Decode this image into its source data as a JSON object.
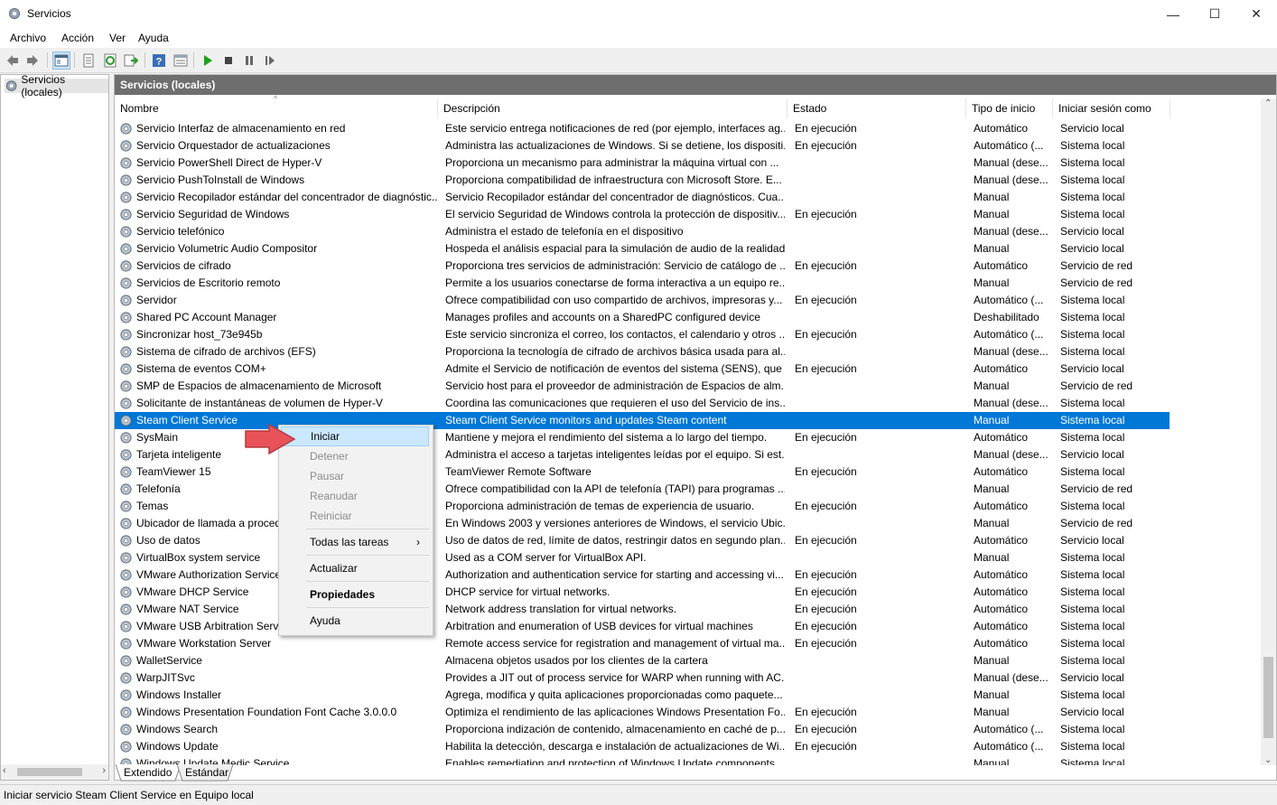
{
  "window": {
    "title": "Servicios",
    "minimize": "—",
    "maximize": "☐",
    "close": "✕"
  },
  "menu": [
    "Archivo",
    "Acción",
    "Ver",
    "Ayuda"
  ],
  "tree": {
    "node": "Servicios (locales)"
  },
  "panel": {
    "header": "Servicios (locales)"
  },
  "columns": [
    "Nombre",
    "Descripción",
    "Estado",
    "Tipo de inicio",
    "Iniciar sesión como"
  ],
  "services": [
    [
      "Servicio Interfaz de almacenamiento en red",
      "Este servicio entrega notificaciones de red (por ejemplo, interfaces ag...",
      "En ejecución",
      "Automático",
      "Servicio local"
    ],
    [
      "Servicio Orquestador de actualizaciones",
      "Administra las actualizaciones de Windows. Si se detiene, los dispositi...",
      "En ejecución",
      "Automático (...",
      "Sistema local"
    ],
    [
      "Servicio PowerShell Direct de Hyper-V",
      "Proporciona un mecanismo para administrar la máquina virtual con ...",
      "",
      "Manual (dese...",
      "Sistema local"
    ],
    [
      "Servicio PushToInstall de Windows",
      "Proporciona compatibilidad de infraestructura con Microsoft Store. E...",
      "",
      "Manual (dese...",
      "Sistema local"
    ],
    [
      "Servicio Recopilador estándar del concentrador de diagnóstic...",
      "Servicio Recopilador estándar del concentrador de diagnósticos. Cua...",
      "",
      "Manual",
      "Sistema local"
    ],
    [
      "Servicio Seguridad de Windows",
      "El servicio Seguridad de Windows controla la protección de dispositiv...",
      "En ejecución",
      "Manual",
      "Sistema local"
    ],
    [
      "Servicio telefónico",
      "Administra el estado de telefonía en el dispositivo",
      "",
      "Manual (dese...",
      "Servicio local"
    ],
    [
      "Servicio Volumetric Audio Compositor",
      "Hospeda el análisis espacial para la simulación de audio de la realidad...",
      "",
      "Manual",
      "Servicio local"
    ],
    [
      "Servicios de cifrado",
      "Proporciona tres servicios de administración: Servicio de catálogo de ...",
      "En ejecución",
      "Automático",
      "Servicio de red"
    ],
    [
      "Servicios de Escritorio remoto",
      "Permite a los usuarios conectarse de forma interactiva a un equipo re...",
      "",
      "Manual",
      "Servicio de red"
    ],
    [
      "Servidor",
      "Ofrece compatibilidad con uso compartido de archivos, impresoras y...",
      "En ejecución",
      "Automático (...",
      "Sistema local"
    ],
    [
      "Shared PC Account Manager",
      "Manages profiles and accounts on a SharedPC configured device",
      "",
      "Deshabilitado",
      "Sistema local"
    ],
    [
      "Sincronizar host_73e945b",
      "Este servicio sincroniza el correo, los contactos, el calendario y otros ...",
      "En ejecución",
      "Automático (...",
      "Sistema local"
    ],
    [
      "Sistema de cifrado de archivos (EFS)",
      "Proporciona la tecnología de cifrado de archivos básica usada para al...",
      "",
      "Manual (dese...",
      "Sistema local"
    ],
    [
      "Sistema de eventos COM+",
      "Admite el Servicio de notificación de eventos del sistema (SENS), que ...",
      "En ejecución",
      "Automático",
      "Servicio local"
    ],
    [
      "SMP de Espacios de almacenamiento de Microsoft",
      "Servicio host para el proveedor de administración de Espacios de alm...",
      "",
      "Manual",
      "Servicio de red"
    ],
    [
      "Solicitante de instantáneas de volumen de Hyper-V",
      "Coordina las comunicaciones que requieren el uso del Servicio de ins...",
      "",
      "Manual (dese...",
      "Sistema local"
    ],
    [
      "Steam Client Service",
      "Steam Client Service monitors and updates Steam content",
      "",
      "Manual",
      "Sistema local"
    ],
    [
      "SysMain",
      "Mantiene y mejora el rendimiento del sistema a lo largo del tiempo.",
      "En ejecución",
      "Automático",
      "Sistema local"
    ],
    [
      "Tarjeta inteligente",
      "Administra el acceso a tarjetas inteligentes leídas por el equipo. Si est...",
      "",
      "Manual (dese...",
      "Servicio local"
    ],
    [
      "TeamViewer 15",
      "TeamViewer Remote Software",
      "En ejecución",
      "Automático",
      "Sistema local"
    ],
    [
      "Telefonía",
      "Ofrece compatibilidad con la API de telefonía (TAPI) para programas ...",
      "",
      "Manual",
      "Servicio de red"
    ],
    [
      "Temas",
      "Proporciona administración de temas de experiencia de usuario.",
      "En ejecución",
      "Automático",
      "Sistema local"
    ],
    [
      "Ubicador de llamada a proced",
      "En Windows 2003 y versiones anteriores de Windows, el servicio Ubic...",
      "",
      "Manual",
      "Servicio de red"
    ],
    [
      "Uso de datos",
      "Uso de datos de red, límite de datos, restringir datos en segundo plan...",
      "En ejecución",
      "Automático",
      "Servicio local"
    ],
    [
      "VirtualBox system service",
      "Used as a COM server for VirtualBox API.",
      "",
      "Manual",
      "Sistema local"
    ],
    [
      "VMware Authorization Service",
      "Authorization and authentication service for starting and accessing vi...",
      "En ejecución",
      "Automático",
      "Sistema local"
    ],
    [
      "VMware DHCP Service",
      "DHCP service for virtual networks.",
      "En ejecución",
      "Automático",
      "Sistema local"
    ],
    [
      "VMware NAT Service",
      "Network address translation for virtual networks.",
      "En ejecución",
      "Automático",
      "Sistema local"
    ],
    [
      "VMware USB Arbitration Servic",
      "Arbitration and enumeration of USB devices for virtual machines",
      "En ejecución",
      "Automático",
      "Sistema local"
    ],
    [
      "VMware Workstation Server",
      "Remote access service for registration and management of virtual ma...",
      "En ejecución",
      "Automático",
      "Sistema local"
    ],
    [
      "WalletService",
      "Almacena objetos usados por los clientes de la cartera",
      "",
      "Manual",
      "Sistema local"
    ],
    [
      "WarpJITSvc",
      "Provides a JIT out of process service for WARP when running with AC...",
      "",
      "Manual (dese...",
      "Servicio local"
    ],
    [
      "Windows Installer",
      "Agrega, modifica y quita aplicaciones proporcionadas como paquete...",
      "",
      "Manual",
      "Sistema local"
    ],
    [
      "Windows Presentation Foundation Font Cache 3.0.0.0",
      "Optimiza el rendimiento de las aplicaciones Windows Presentation Fo...",
      "En ejecución",
      "Manual",
      "Servicio local"
    ],
    [
      "Windows Search",
      "Proporciona indización de contenido, almacenamiento en caché de p...",
      "En ejecución",
      "Automático (...",
      "Sistema local"
    ],
    [
      "Windows Update",
      "Habilita la detección, descarga e instalación de actualizaciones de Wi...",
      "En ejecución",
      "Automático (...",
      "Sistema local"
    ],
    [
      "Windows Update Medic Service",
      "Enables remediation and protection of Windows Update components",
      "",
      "Manual",
      "Sistema local"
    ]
  ],
  "selected_service": "Steam Client Service",
  "context_menu": {
    "start": "Iniciar",
    "stop": "Detener",
    "pause": "Pausar",
    "resume": "Reanudar",
    "restart": "Reiniciar",
    "all_tasks": "Todas las tareas",
    "refresh": "Actualizar",
    "properties": "Propiedades",
    "help": "Ayuda",
    "submenu_arrow": "›"
  },
  "tabs": [
    "Extendido",
    "Estándar"
  ],
  "status": "Iniciar servicio Steam Client Service en Equipo local",
  "colors": {
    "selection": "#0078d7",
    "panel_header": "#6e6e6e",
    "menu_highlight": "#cce8ff",
    "arrow": "#e8535a",
    "play_icon": "#1aa31a"
  },
  "icons": [
    "back-icon",
    "forward-icon",
    "console-tree-icon",
    "properties-icon",
    "refresh-icon",
    "export-icon",
    "help-icon",
    "view-icon",
    "play-icon",
    "stop-icon",
    "pause-icon",
    "restart-icon",
    "gear-icon"
  ]
}
